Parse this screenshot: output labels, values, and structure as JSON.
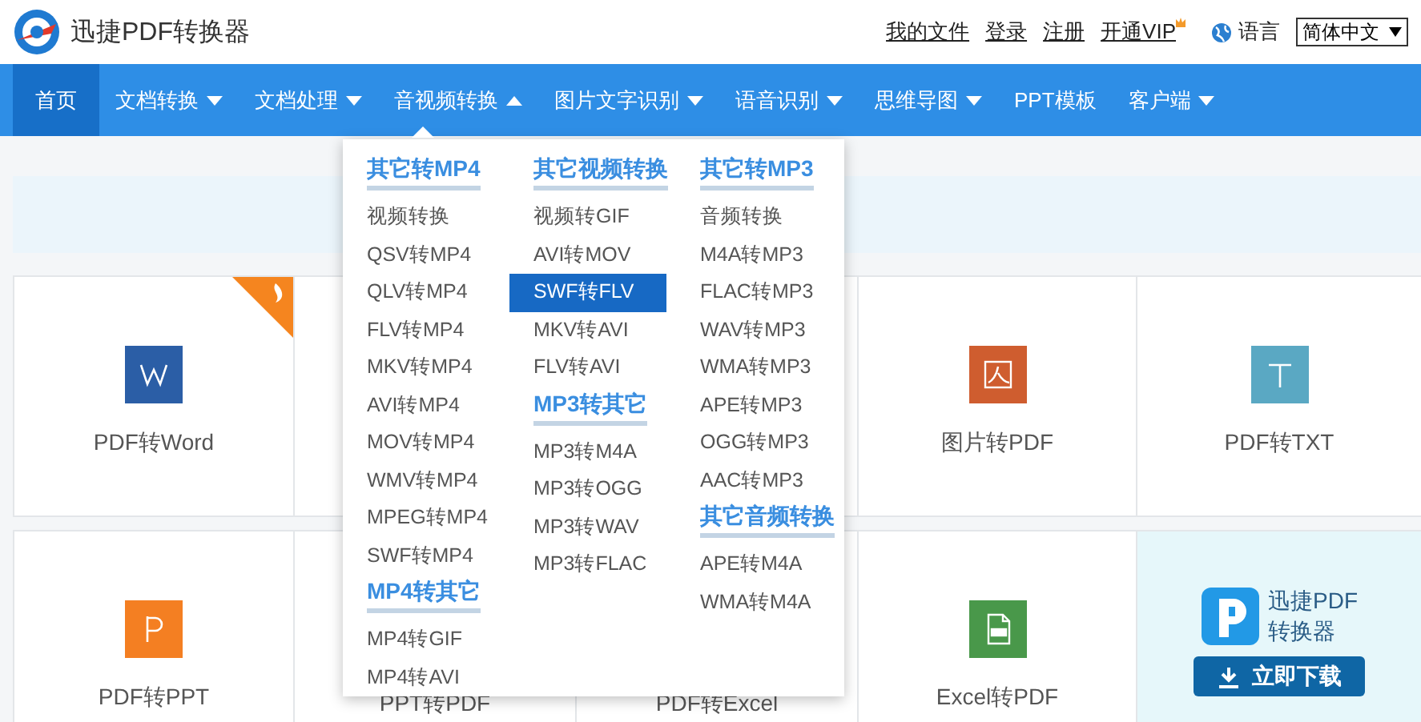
{
  "header": {
    "title": "迅捷PDF转换器",
    "links": [
      "我的文件",
      "登录",
      "注册",
      "开通VIP"
    ],
    "language_label": "语言",
    "language_select": "简体中文"
  },
  "nav": [
    {
      "label": "首页",
      "selected": true,
      "kind": "link"
    },
    {
      "label": "文档转换",
      "selected": false,
      "kind": "menu",
      "expanded": false
    },
    {
      "label": "文档处理",
      "selected": false,
      "kind": "menu",
      "expanded": false
    },
    {
      "label": "音视频转换",
      "selected": false,
      "kind": "menu",
      "expanded": true
    },
    {
      "label": "图片文字识别",
      "selected": false,
      "kind": "menu",
      "expanded": false
    },
    {
      "label": "语音识别",
      "selected": false,
      "kind": "menu",
      "expanded": false
    },
    {
      "label": "思维导图",
      "selected": false,
      "kind": "menu",
      "expanded": false
    },
    {
      "label": "PPT模板",
      "selected": false,
      "kind": "link"
    },
    {
      "label": "客户端",
      "selected": false,
      "kind": "menu",
      "expanded": false
    }
  ],
  "dropdown": {
    "columns": [
      [
        {
          "heading": "其它转MP4",
          "items": [
            {
              "label": "视频转换",
              "selected": false
            },
            {
              "label": "QSV转MP4",
              "selected": false
            },
            {
              "label": "QLV转MP4",
              "selected": false
            },
            {
              "label": "FLV转MP4",
              "selected": false
            },
            {
              "label": "MKV转MP4",
              "selected": false
            },
            {
              "label": "AVI转MP4",
              "selected": false
            },
            {
              "label": "MOV转MP4",
              "selected": false
            },
            {
              "label": "WMV转MP4",
              "selected": false
            },
            {
              "label": "MPEG转MP4",
              "selected": false
            },
            {
              "label": "SWF转MP4",
              "selected": false
            }
          ]
        },
        {
          "heading": "MP4转其它",
          "items": [
            {
              "label": "MP4转GIF",
              "selected": false
            },
            {
              "label": "MP4转AVI",
              "selected": false
            }
          ]
        }
      ],
      [
        {
          "heading": "其它视频转换",
          "items": [
            {
              "label": "视频转GIF",
              "selected": false
            },
            {
              "label": "AVI转MOV",
              "selected": false
            },
            {
              "label": "SWF转FLV",
              "selected": true
            },
            {
              "label": "MKV转AVI",
              "selected": false
            },
            {
              "label": "FLV转AVI",
              "selected": false
            }
          ]
        },
        {
          "heading": "MP3转其它",
          "items": [
            {
              "label": "MP3转M4A",
              "selected": false
            },
            {
              "label": "MP3转OGG",
              "selected": false
            },
            {
              "label": "MP3转WAV",
              "selected": false
            },
            {
              "label": "MP3转FLAC",
              "selected": false
            }
          ]
        }
      ],
      [
        {
          "heading": "其它转MP3",
          "items": [
            {
              "label": "音频转换",
              "selected": false
            },
            {
              "label": "M4A转MP3",
              "selected": false
            },
            {
              "label": "FLAC转MP3",
              "selected": false
            },
            {
              "label": "WAV转MP3",
              "selected": false
            },
            {
              "label": "WMA转MP3",
              "selected": false
            },
            {
              "label": "APE转MP3",
              "selected": false
            },
            {
              "label": "OGG转MP3",
              "selected": false
            },
            {
              "label": "AAC转MP3",
              "selected": false
            }
          ]
        },
        {
          "heading": "其它音频转换",
          "items": [
            {
              "label": "APE转M4A",
              "selected": false
            },
            {
              "label": "WMA转M4A",
              "selected": false
            }
          ]
        }
      ]
    ]
  },
  "cards": [
    {
      "kind": "word",
      "label": "PDF转Word",
      "hot": true
    },
    {
      "kind": "blank"
    },
    {
      "kind": "blank"
    },
    {
      "kind": "image",
      "label": "图片转PDF",
      "hot": false
    },
    {
      "kind": "txt",
      "label": "PDF转TXT",
      "hot": false
    },
    {
      "kind": "ppt",
      "label": "PDF转PPT",
      "hot": false
    },
    {
      "kind": "plain",
      "label": "PPT转PDF",
      "hot": false
    },
    {
      "kind": "plain",
      "label": "PDF转Excel",
      "hot": false
    },
    {
      "kind": "excel",
      "label": "Excel转PDF",
      "hot": false
    },
    {
      "kind": "promo",
      "lines": [
        "迅捷PDF",
        "转换器"
      ],
      "button": "立即下载"
    }
  ]
}
